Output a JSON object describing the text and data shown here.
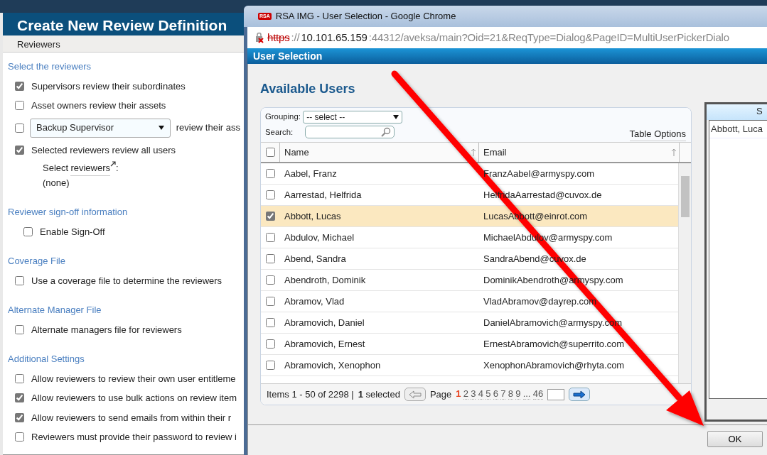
{
  "page": {
    "title": "Create New Review Definition",
    "tab": "Reviewers",
    "sections": [
      {
        "heading": "Select the reviewers",
        "options": [
          {
            "kind": "checkbox",
            "label": "Supervisors review their subordinates",
            "checked": true
          },
          {
            "kind": "checkbox",
            "label": "Asset owners review their assets",
            "checked": false
          },
          {
            "kind": "select",
            "checked": false,
            "dropdown_value": "Backup Supervisor",
            "label": "review their ass"
          },
          {
            "kind": "checkbox",
            "label": "Selected reviewers review all users",
            "checked": true
          },
          {
            "kind": "picker",
            "prefix": "Select",
            "link": "reviewers",
            "suffix": ":",
            "value": "(none)"
          }
        ]
      },
      {
        "heading": "Reviewer sign-off information",
        "options": [
          {
            "kind": "checkbox",
            "label": "Enable Sign-Off",
            "checked": false
          }
        ]
      },
      {
        "heading": "Coverage File",
        "options": [
          {
            "kind": "checkbox",
            "label": "Use a coverage file to determine the reviewers",
            "checked": false
          }
        ]
      },
      {
        "heading": "Alternate Manager File",
        "options": [
          {
            "kind": "checkbox",
            "label": "Alternate managers file for reviewers",
            "checked": false
          }
        ]
      },
      {
        "heading": "Additional Settings",
        "options": [
          {
            "kind": "checkbox",
            "label": "Allow reviewers to review their own user entitleme",
            "checked": false
          },
          {
            "kind": "checkbox",
            "label": "Allow reviewers to use bulk actions on review item",
            "checked": true
          },
          {
            "kind": "checkbox",
            "label": "Allow reviewers to send emails from within their r",
            "checked": true
          },
          {
            "kind": "checkbox",
            "label": "Reviewers must provide their password to review i",
            "checked": false
          }
        ]
      }
    ]
  },
  "dialog": {
    "window_title": "RSA IMG - User Selection - Google Chrome",
    "app_badge": "RSA",
    "url": {
      "scheme": "https",
      "separator": "://",
      "host": "10.101.65.159",
      "rest": ":44312/aveksa/main?Oid=21&ReqType=Dialog&PageID=MultiUserPickerDialo"
    },
    "header": "User Selection",
    "heading": "Available Users",
    "grouping_label": "Grouping:",
    "grouping_value": "-- select --",
    "search_label": "Search:",
    "table_options": "Table Options",
    "select_all_checked": false,
    "columns": [
      "Name",
      "Email"
    ],
    "rows": [
      {
        "name": "Aabel, Franz",
        "email": "FranzAabel@armyspy.com",
        "selected": false
      },
      {
        "name": "Aarrestad, Helfrida",
        "email": "HelfridaAarrestad@cuvox.de",
        "selected": false
      },
      {
        "name": "Abbott, Lucas",
        "email": "LucasAbbott@einrot.com",
        "selected": true
      },
      {
        "name": "Abdulov, Michael",
        "email": "MichaelAbdulov@armyspy.com",
        "selected": false
      },
      {
        "name": "Abend, Sandra",
        "email": "SandraAbend@cuvox.de",
        "selected": false
      },
      {
        "name": "Abendroth, Dominik",
        "email": "DominikAbendroth@armyspy.com",
        "selected": false
      },
      {
        "name": "Abramov, Vlad",
        "email": "VladAbramov@dayrep.com",
        "selected": false
      },
      {
        "name": "Abramovich, Daniel",
        "email": "DanielAbramovich@armyspy.com",
        "selected": false
      },
      {
        "name": "Abramovich, Ernest",
        "email": "ErnestAbramovich@superrito.com",
        "selected": false
      },
      {
        "name": "Abramovich, Xenophon",
        "email": "XenophonAbramovich@rhyta.com",
        "selected": false
      }
    ],
    "footer": {
      "items": "Items 1 - 50 of 2298 |",
      "selected_count": "1",
      "selected_label": "selected",
      "page_label": "Page",
      "pages": [
        {
          "label": "1",
          "selected": true
        },
        {
          "label": "2",
          "selected": false
        },
        {
          "label": "3",
          "selected": false
        },
        {
          "label": "4",
          "selected": false
        },
        {
          "label": "5",
          "selected": false
        },
        {
          "label": "6",
          "selected": false
        },
        {
          "label": "7",
          "selected": false
        },
        {
          "label": "8",
          "selected": false
        },
        {
          "label": "9",
          "selected": false
        },
        {
          "label": "...",
          "selected": false
        },
        {
          "label": "46",
          "selected": false
        }
      ]
    },
    "selected_panel": {
      "header": "S",
      "items": [
        "Abbott, Luca"
      ]
    },
    "ok": "OK"
  }
}
